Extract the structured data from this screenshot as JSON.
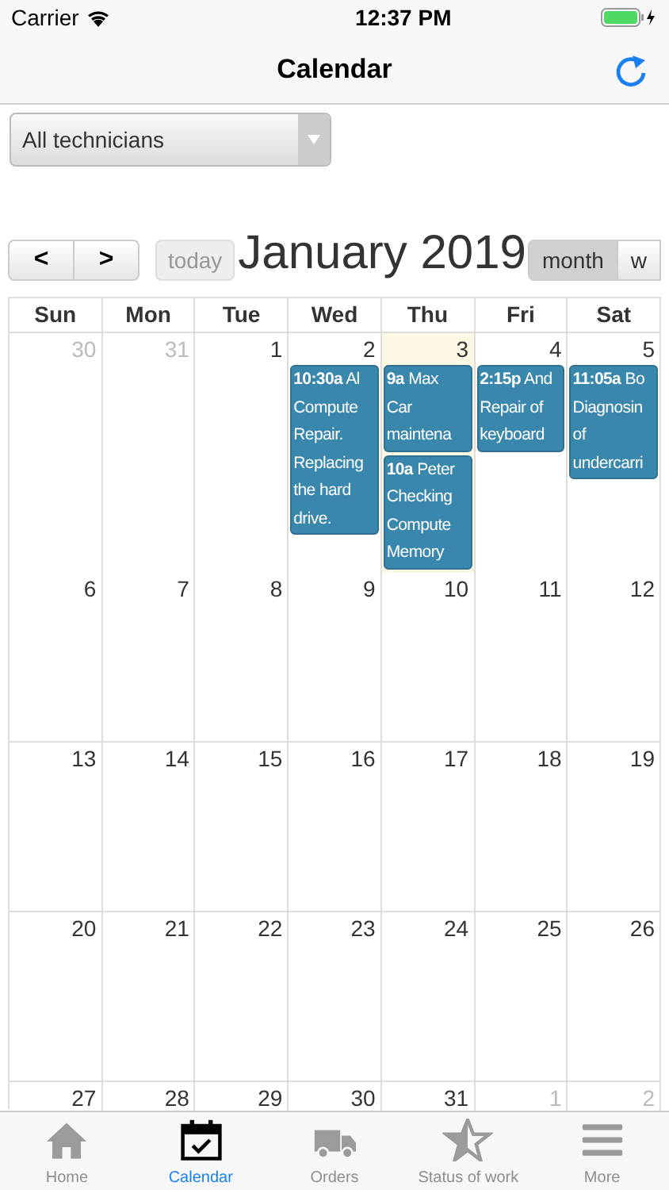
{
  "status_bar": {
    "carrier": "Carrier",
    "time": "12:37 PM"
  },
  "nav": {
    "title": "Calendar"
  },
  "filter": {
    "value": "All technicians"
  },
  "toolbar": {
    "prev": "<",
    "next": ">",
    "today": "today",
    "title": "January 2019",
    "views": [
      {
        "label": "month",
        "selected": true
      },
      {
        "label": "w",
        "selected": false
      }
    ]
  },
  "calendar": {
    "weekdays": [
      "Sun",
      "Mon",
      "Tue",
      "Wed",
      "Thu",
      "Fri",
      "Sat"
    ],
    "weeks": [
      [
        {
          "day": "30",
          "other_month": true,
          "today": false
        },
        {
          "day": "31",
          "other_month": true,
          "today": false
        },
        {
          "day": "1",
          "other_month": false,
          "today": false
        },
        {
          "day": "2",
          "other_month": false,
          "today": false,
          "events": [
            {
              "time": "10:30a",
              "title": "Al",
              "lines": [
                "Compute",
                "Repair.",
                "Replacing",
                "the hard",
                "drive."
              ]
            }
          ]
        },
        {
          "day": "3",
          "other_month": false,
          "today": true,
          "events": [
            {
              "time": "9a",
              "title": "Max",
              "lines": [
                "Car",
                "maintena"
              ]
            },
            {
              "time": "10a",
              "title": "Peter",
              "lines": [
                "Checking",
                "Compute",
                "Memory"
              ]
            }
          ]
        },
        {
          "day": "4",
          "other_month": false,
          "today": false,
          "events": [
            {
              "time": "2:15p",
              "title": "And",
              "lines": [
                "Repair of",
                "keyboard"
              ]
            }
          ]
        },
        {
          "day": "5",
          "other_month": false,
          "today": false,
          "events": [
            {
              "time": "11:05a",
              "title": "Bo",
              "lines": [
                "Diagnosin",
                "of",
                "undercarri"
              ]
            }
          ]
        }
      ],
      [
        {
          "day": "6",
          "other_month": false,
          "today": false
        },
        {
          "day": "7",
          "other_month": false,
          "today": false
        },
        {
          "day": "8",
          "other_month": false,
          "today": false
        },
        {
          "day": "9",
          "other_month": false,
          "today": false
        },
        {
          "day": "10",
          "other_month": false,
          "today": false
        },
        {
          "day": "11",
          "other_month": false,
          "today": false
        },
        {
          "day": "12",
          "other_month": false,
          "today": false
        }
      ],
      [
        {
          "day": "13",
          "other_month": false,
          "today": false
        },
        {
          "day": "14",
          "other_month": false,
          "today": false
        },
        {
          "day": "15",
          "other_month": false,
          "today": false
        },
        {
          "day": "16",
          "other_month": false,
          "today": false
        },
        {
          "day": "17",
          "other_month": false,
          "today": false
        },
        {
          "day": "18",
          "other_month": false,
          "today": false
        },
        {
          "day": "19",
          "other_month": false,
          "today": false
        }
      ],
      [
        {
          "day": "20",
          "other_month": false,
          "today": false
        },
        {
          "day": "21",
          "other_month": false,
          "today": false
        },
        {
          "day": "22",
          "other_month": false,
          "today": false
        },
        {
          "day": "23",
          "other_month": false,
          "today": false
        },
        {
          "day": "24",
          "other_month": false,
          "today": false
        },
        {
          "day": "25",
          "other_month": false,
          "today": false
        },
        {
          "day": "26",
          "other_month": false,
          "today": false
        }
      ],
      [
        {
          "day": "27",
          "other_month": false,
          "today": false
        },
        {
          "day": "28",
          "other_month": false,
          "today": false
        },
        {
          "day": "29",
          "other_month": false,
          "today": false
        },
        {
          "day": "30",
          "other_month": false,
          "today": false
        },
        {
          "day": "31",
          "other_month": false,
          "today": false
        },
        {
          "day": "1",
          "other_month": true,
          "today": false
        },
        {
          "day": "2",
          "other_month": true,
          "today": false
        }
      ]
    ]
  },
  "tabs": [
    {
      "kind": "home",
      "label": "Home",
      "selected": false
    },
    {
      "kind": "calendar",
      "label": "Calendar",
      "selected": true
    },
    {
      "kind": "orders",
      "label": "Orders",
      "selected": false
    },
    {
      "kind": "status",
      "label": "Status of work",
      "selected": false
    },
    {
      "kind": "more",
      "label": "More",
      "selected": false
    }
  ]
}
